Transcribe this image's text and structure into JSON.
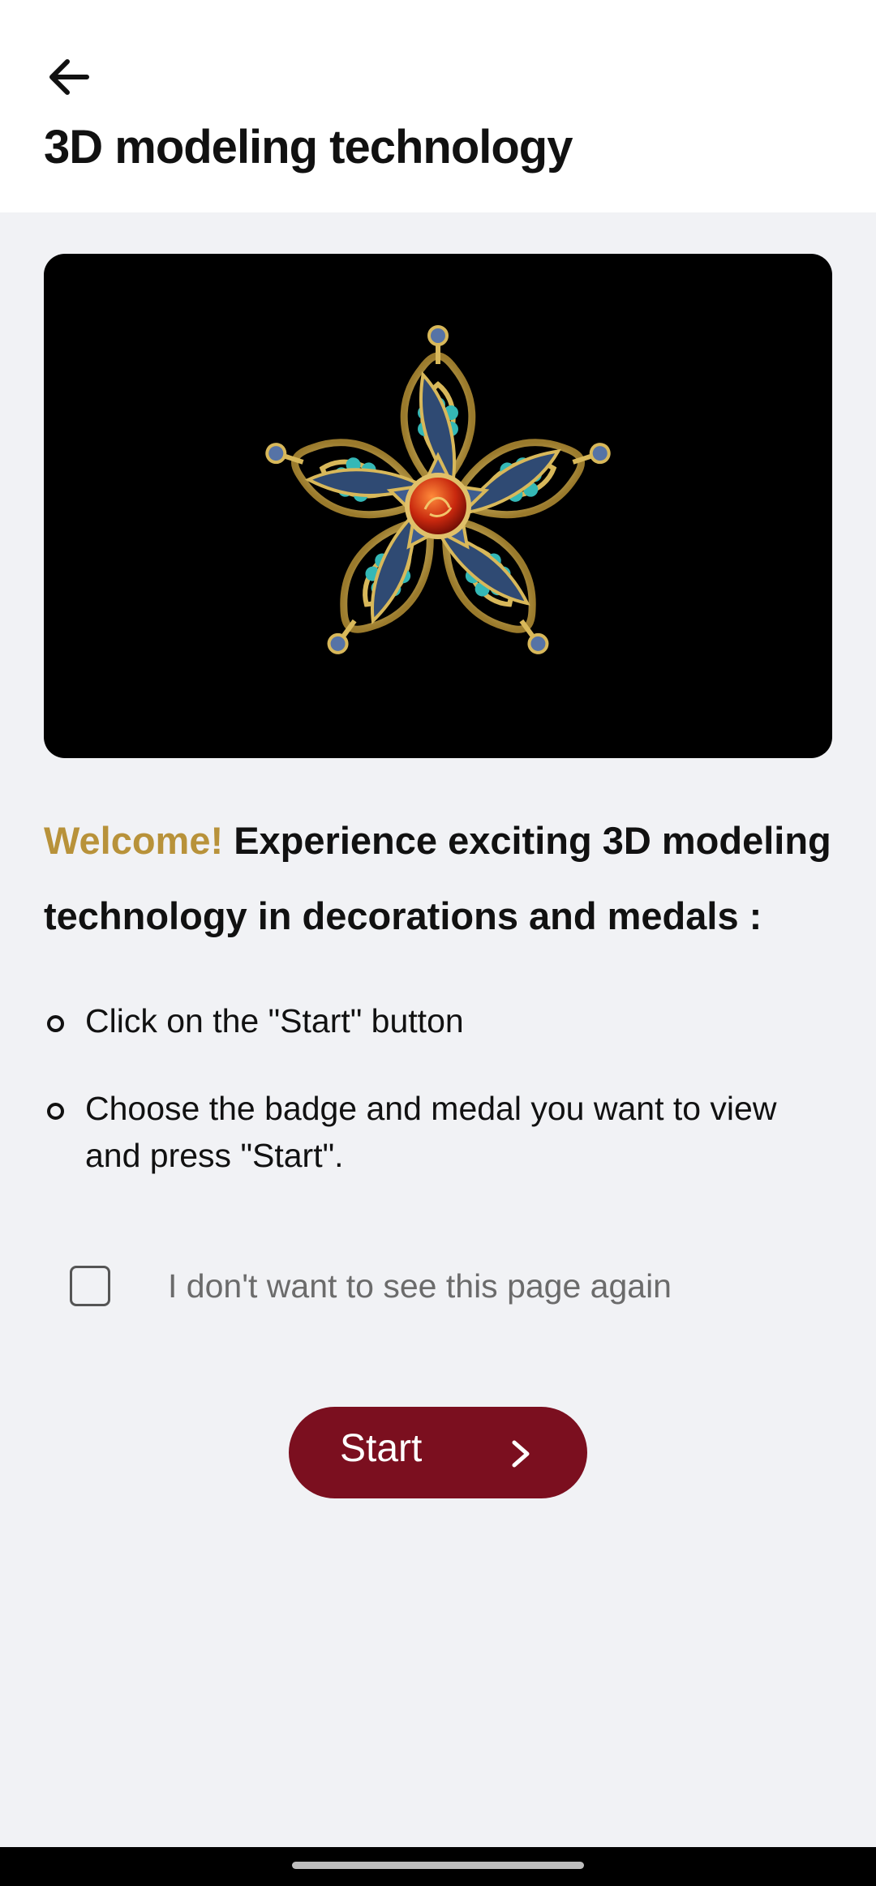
{
  "header": {
    "back_icon": "arrow-left-icon",
    "title": "3D modeling technology"
  },
  "hero": {
    "image_subject": "jeweled star-shaped medal on black background"
  },
  "intro": {
    "welcome": "Welcome!",
    "text": " Experience exciting 3D modeling technology in decorations and medals :"
  },
  "steps": [
    "Click on the \"Start\" button",
    "Choose the badge and medal you want to view and press \"Start\"."
  ],
  "optout": {
    "label": "I don't want to see this page again",
    "checked": false
  },
  "start_button": {
    "label": "Start",
    "icon": "chevron-right-icon"
  },
  "colors": {
    "accent": "#b8923a",
    "primary_button": "#7b0f1f",
    "background": "#f1f2f5"
  }
}
